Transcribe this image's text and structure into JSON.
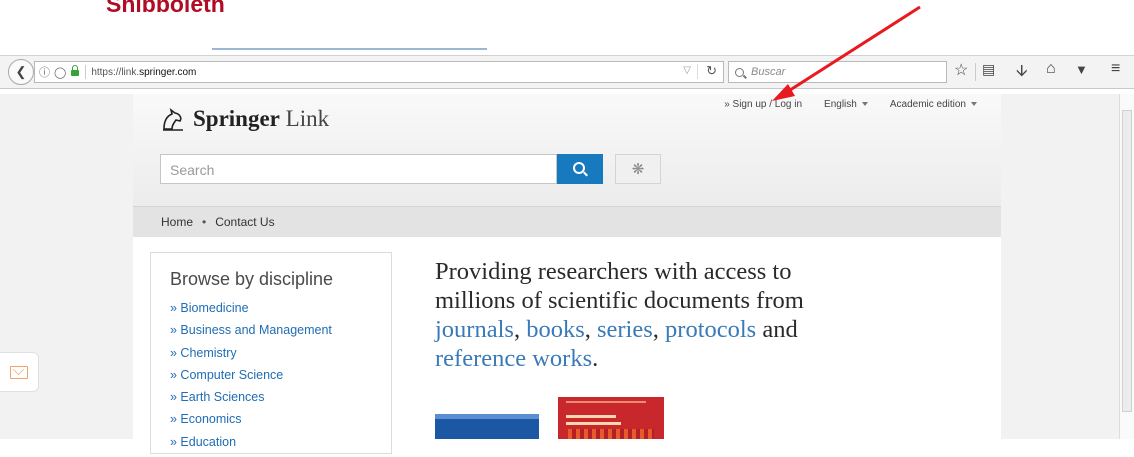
{
  "annotation": {
    "top_label": "Shibboleth",
    "arrow_color": "#e8191f"
  },
  "browser": {
    "url_host_prefix": "https://link.",
    "url_host_main": "springer.com",
    "search_placeholder": "Buscar",
    "icons": [
      "back-icon",
      "info-icon",
      "shield-icon",
      "lock-icon",
      "dropdown-icon",
      "reload-icon",
      "search-icon",
      "star-icon",
      "reading-list-icon",
      "download-icon",
      "home-icon",
      "pocket-icon",
      "menu-icon"
    ]
  },
  "header": {
    "logo_bold": "Springer",
    "logo_light": "Link",
    "sign_in": "» Sign up / Log in",
    "language": "English",
    "edition": "Academic edition"
  },
  "search": {
    "placeholder": "Search"
  },
  "nav": {
    "home": "Home",
    "separator": "•",
    "contact": "Contact Us"
  },
  "browse": {
    "title": "Browse by discipline",
    "items": [
      "» Biomedicine",
      "» Business and Management",
      "» Chemistry",
      "» Computer Science",
      "» Earth Sciences",
      "» Economics",
      "» Education"
    ]
  },
  "promo": {
    "line1": "Providing researchers with access to",
    "line2": "millions of scientific documents from",
    "link_journals": "journals",
    "sep1": ", ",
    "link_books": "books",
    "sep2": ", ",
    "link_series": "series",
    "sep3": ", ",
    "link_protocols": "protocols",
    "word_and": " and",
    "link_reference": "reference works",
    "end": "."
  },
  "colors": {
    "brand_blue": "#1779be",
    "link_blue": "#1f6db4",
    "annotation_red": "#b00c25"
  }
}
